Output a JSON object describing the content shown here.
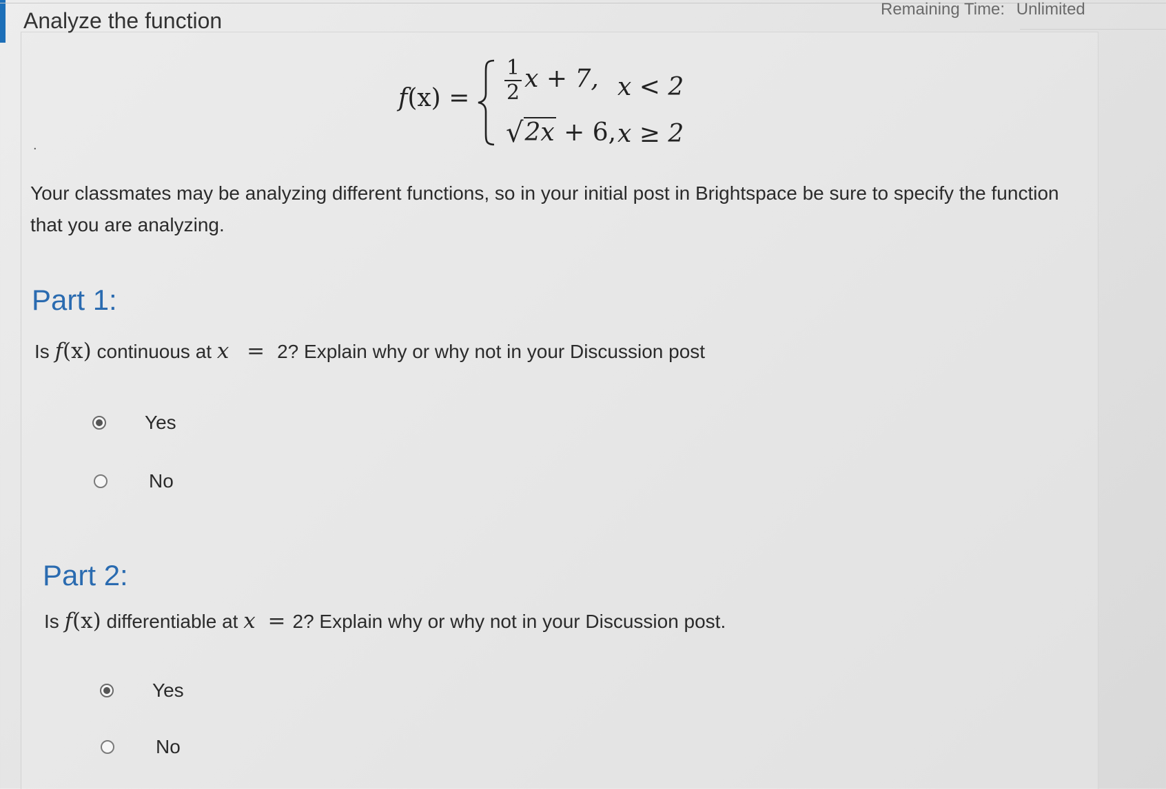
{
  "header": {
    "title": "Analyze the function",
    "remaining_time_label": "Remaining Time:",
    "remaining_time_value": "Unlimited"
  },
  "formula": {
    "lhs_name": "f",
    "lhs_arg": "(x)",
    "equals": "=",
    "case1": {
      "frac_num": "1",
      "frac_den": "2",
      "expr": "x + 7,",
      "condition": "x < 2"
    },
    "case2": {
      "radicand": "2x",
      "expr": "+ 6,",
      "condition": "x ≥ 2"
    }
  },
  "instructions": "Your classmates may be analyzing different functions, so in your initial post in Brightspace be sure to specify the function that you are analyzing.",
  "part1": {
    "title": "Part 1:",
    "q_before": "Is",
    "q_func": "f",
    "q_arg": "(x)",
    "q_middle": "continuous at",
    "q_var": "x",
    "q_eq": "=",
    "q_after": "2? Explain why or why not in your Discussion post",
    "options": [
      {
        "label": "Yes",
        "selected": true
      },
      {
        "label": "No",
        "selected": false
      }
    ]
  },
  "part2": {
    "title": "Part 2:",
    "q_before": "Is",
    "q_func": "f",
    "q_arg": "(x)",
    "q_middle": "differentiable at",
    "q_var": "x",
    "q_eq": "=",
    "q_after": "2? Explain why or why not in your Discussion post.",
    "options": [
      {
        "label": "Yes",
        "selected": true
      },
      {
        "label": "No",
        "selected": false
      }
    ]
  }
}
